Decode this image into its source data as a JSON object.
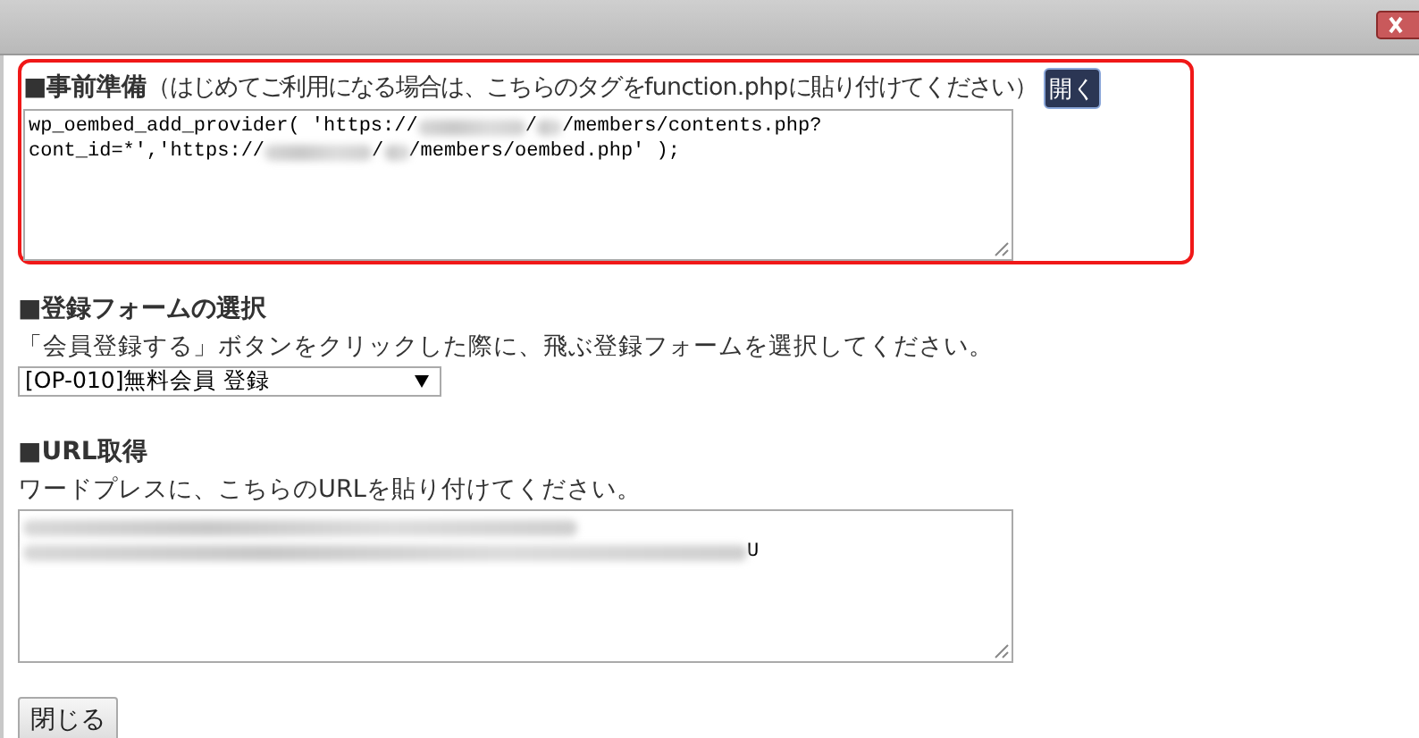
{
  "prep": {
    "heading": "■事前準備",
    "note": "（はじめてご利用になる場合は、こちらのタグをfunction.phpに貼り付けてください）",
    "open_button": "開く",
    "code_lines": [
      [
        {
          "kind": "text",
          "text": "wp_oembed_add_provider( 'https://"
        },
        {
          "kind": "redacted_long"
        },
        {
          "kind": "text",
          "text": "/"
        },
        {
          "kind": "redacted_short"
        },
        {
          "kind": "text",
          "text": "/members/contents.php?"
        }
      ],
      [
        {
          "kind": "text",
          "text": "cont_id=*','https://"
        },
        {
          "kind": "redacted_long"
        },
        {
          "kind": "text",
          "text": "/"
        },
        {
          "kind": "redacted_short"
        },
        {
          "kind": "text",
          "text": "/members/oembed.php' );"
        }
      ]
    ]
  },
  "form_select": {
    "heading": "■登録フォームの選択",
    "description": "「会員登録する」ボタンをクリックした際に、飛ぶ登録フォームを選択してください。",
    "value": "[OP-010]無料会員 登録"
  },
  "url": {
    "heading": "■URL取得",
    "description": "ワードプレスに、こちらのURLを貼り付けてください。",
    "code_lines": [
      [
        {
          "kind": "redacted_wide"
        }
      ],
      [
        {
          "kind": "redacted_full"
        },
        {
          "kind": "text",
          "text": "U"
        }
      ]
    ]
  },
  "close_button": "閉じる"
}
